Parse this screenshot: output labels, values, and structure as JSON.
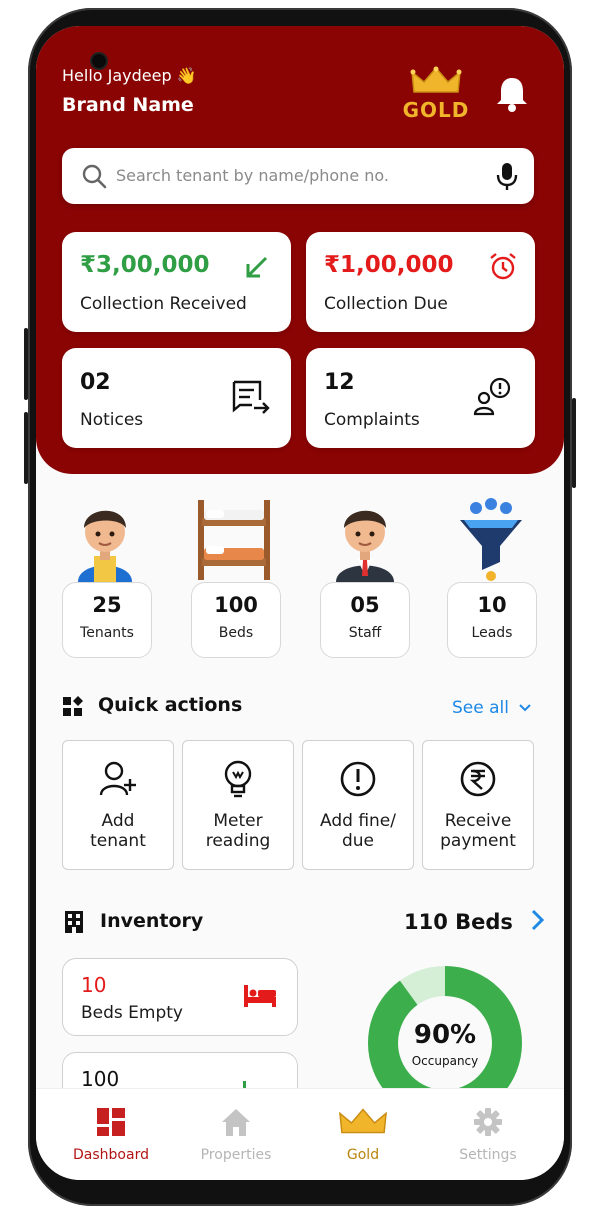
{
  "header": {
    "greeting": "Hello Jaydeep 👋",
    "brand_name": "Brand Name",
    "plan_badge": "GOLD"
  },
  "search": {
    "placeholder": "Search tenant by name/phone no."
  },
  "summary_cards": [
    {
      "value": "₹3,00,000",
      "label": "Collection Received",
      "color": "#2f9e44"
    },
    {
      "value": "₹1,00,000",
      "label": "Collection Due",
      "color": "#e31b1b"
    },
    {
      "value": "02",
      "label": "Notices"
    },
    {
      "value": "12",
      "label": "Complaints"
    }
  ],
  "stats": [
    {
      "value": "25",
      "label": "Tenants"
    },
    {
      "value": "100",
      "label": "Beds"
    },
    {
      "value": "05",
      "label": "Staff"
    },
    {
      "value": "10",
      "label": "Leads"
    }
  ],
  "quick_actions": {
    "title": "Quick actions",
    "see_all": "See all",
    "items": [
      {
        "line1": "Add",
        "line2": "tenant",
        "icon": "add-user-icon"
      },
      {
        "line1": "Meter",
        "line2": "reading",
        "icon": "bulb-icon"
      },
      {
        "line1": "Add fine/",
        "line2": "due",
        "icon": "alert-circle-icon"
      },
      {
        "line1": "Receive",
        "line2": "payment",
        "icon": "rupee-icon"
      }
    ]
  },
  "inventory": {
    "title": "Inventory",
    "total": "110 Beds",
    "cards": [
      {
        "value": "10",
        "label": "Beds Empty",
        "color": "#e31b1b"
      },
      {
        "value": "100",
        "label": ""
      }
    ],
    "occupancy": {
      "percent": 90,
      "value_label": "90%",
      "label": "Occupancy"
    }
  },
  "tabbar": [
    {
      "label": "Dashboard",
      "active": true
    },
    {
      "label": "Properties",
      "active": false
    },
    {
      "label": "Gold",
      "active": false
    },
    {
      "label": "Settings",
      "active": false
    }
  ],
  "colors": {
    "header_bg": "#8a0404",
    "gold": "#f0b52a",
    "accent_blue": "#1e88e5",
    "donut_green": "#3dae4c",
    "donut_light": "#d5efd6"
  }
}
